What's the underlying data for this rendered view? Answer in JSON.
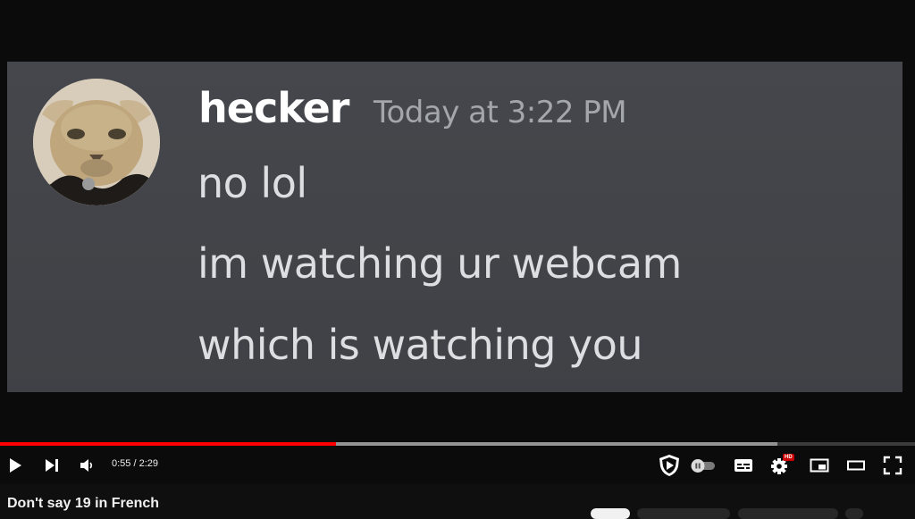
{
  "chat": {
    "username": "hecker",
    "timestamp": "Today at 3:22 PM",
    "messages": [
      "no lol",
      "im watching ur webcam",
      "which is watching you"
    ]
  },
  "player": {
    "current_time": "0:55",
    "separator": " / ",
    "duration": "2:29",
    "played_fraction": 0.367,
    "buffered_fraction": 0.85,
    "settings_badge": "HD"
  },
  "colors": {
    "progress_played": "#ff0000",
    "chat_background": "#45474c",
    "hd_badge": "#cc0000"
  },
  "icons": {
    "play": "play-icon",
    "next": "next-icon",
    "volume": "volume-icon",
    "shield": "shield-icon",
    "autoplay": "autoplay-toggle-icon",
    "subtitles": "subtitles-icon",
    "settings": "gear-icon",
    "miniplayer": "miniplayer-icon",
    "theater": "theater-icon",
    "fullscreen": "fullscreen-icon"
  },
  "video": {
    "title": "Don't say 19 in French"
  }
}
